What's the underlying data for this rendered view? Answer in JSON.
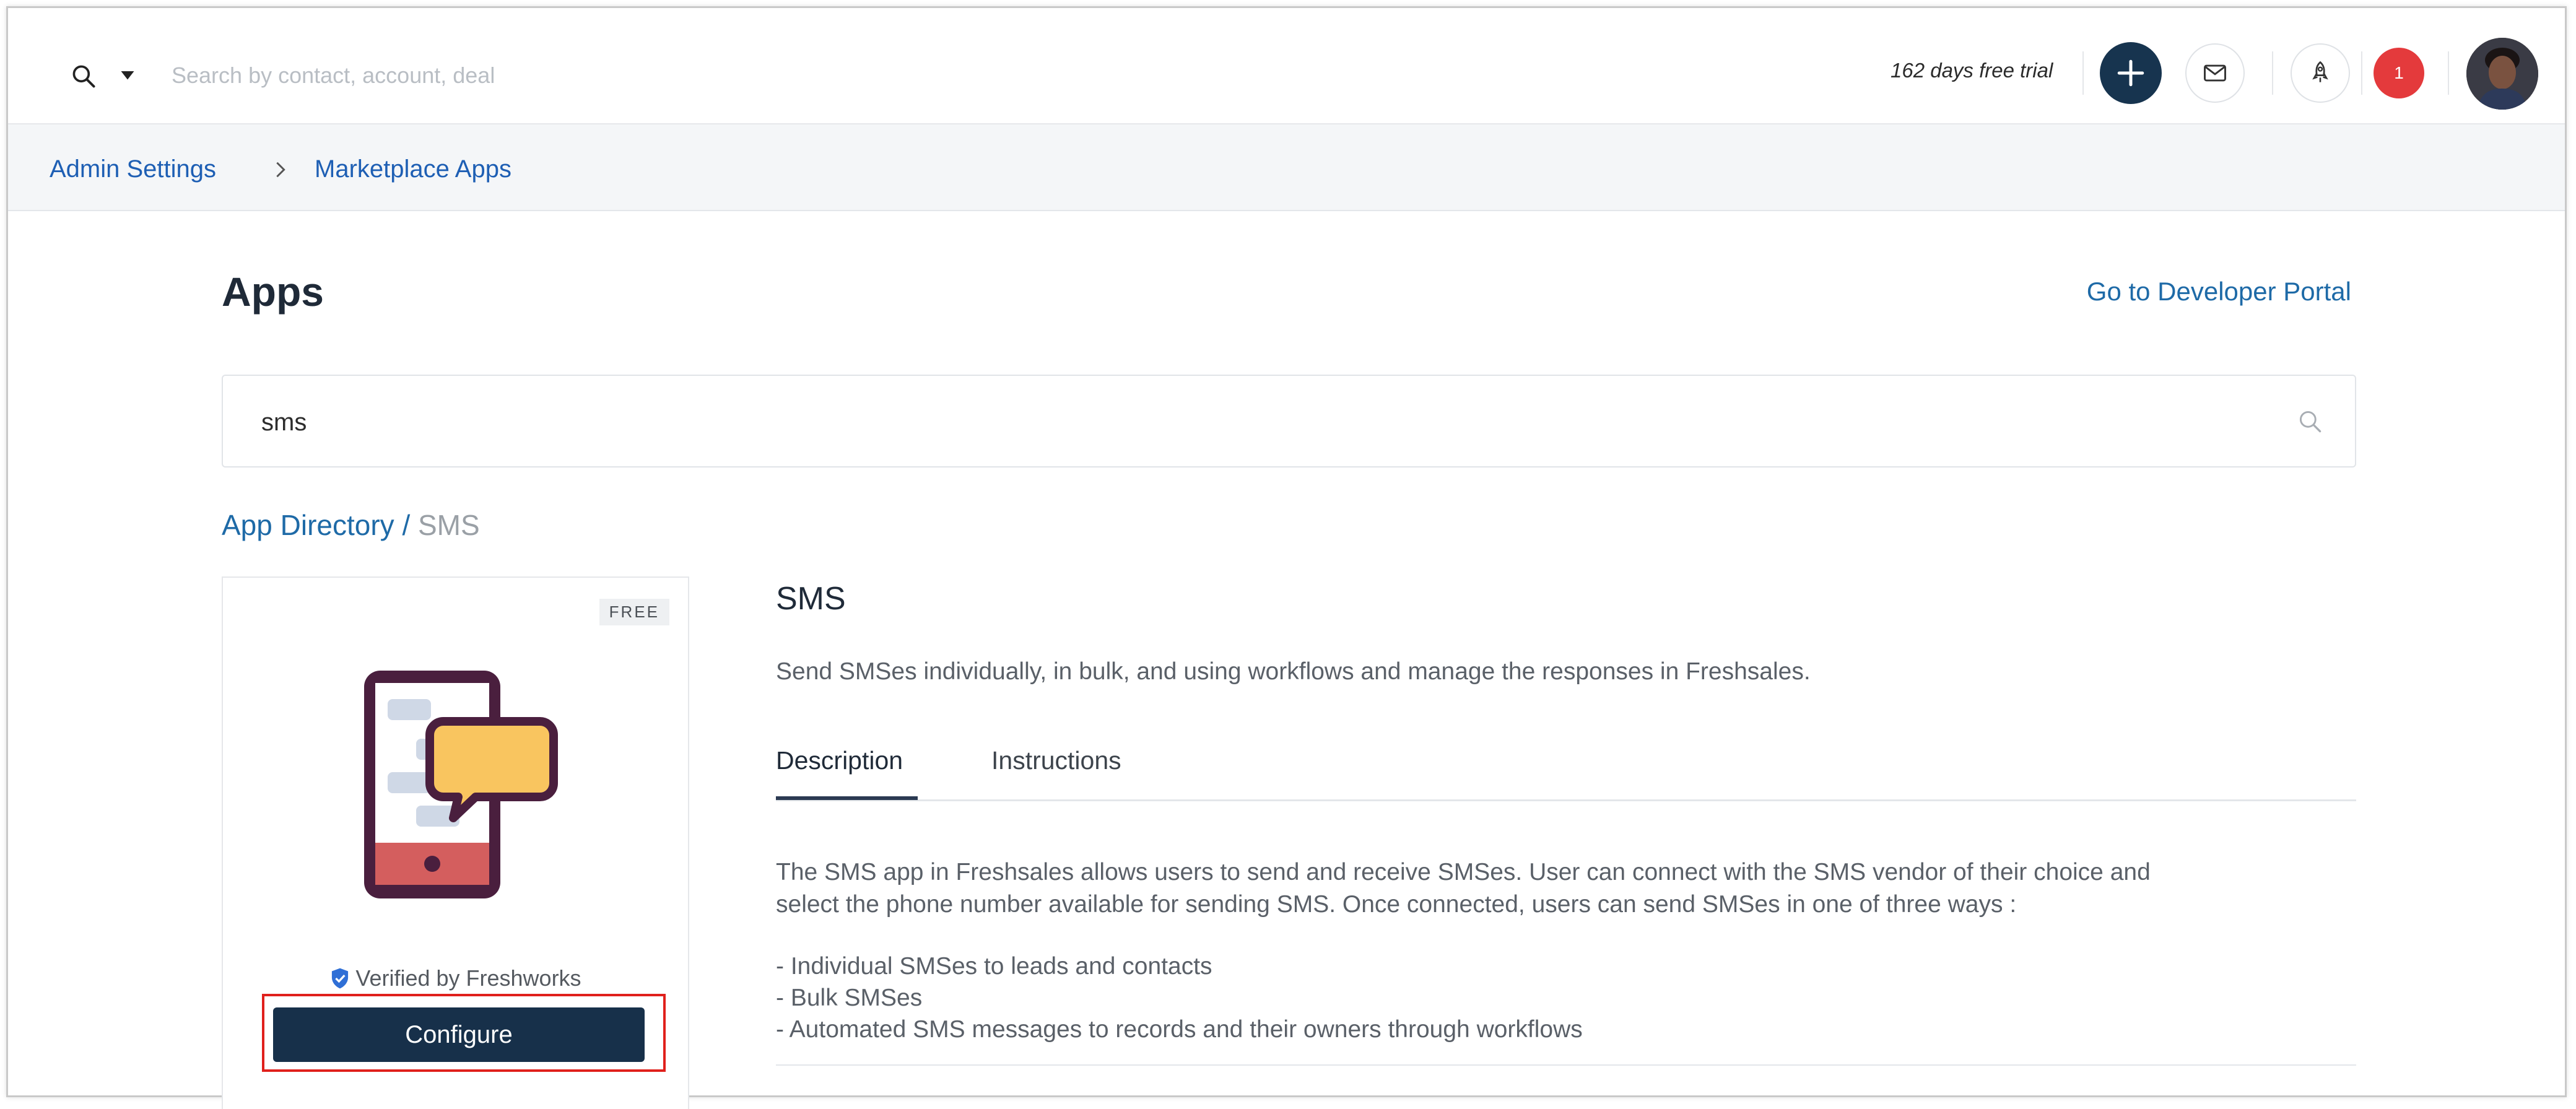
{
  "topbar": {
    "search_placeholder": "Search by contact, account, deal",
    "trial_text": "162 days free trial",
    "notification_count": "1"
  },
  "breadcrumb": {
    "items": [
      "Admin Settings",
      "Marketplace Apps"
    ]
  },
  "page": {
    "title": "Apps",
    "developer_portal_link": "Go to Developer Portal",
    "search_value": "sms",
    "directory_link": "App Directory",
    "directory_separator": "/",
    "directory_current": "SMS"
  },
  "app_card": {
    "badge": "FREE",
    "verified_text": "Verified by Freshworks",
    "configure_label": "Configure"
  },
  "app": {
    "name": "SMS",
    "summary": "Send SMSes individually, in bulk, and using workflows and manage the responses in Freshsales.",
    "tabs": [
      {
        "label": "Description",
        "active": true
      },
      {
        "label": "Instructions",
        "active": false
      }
    ],
    "description_lines": [
      "The SMS app in Freshsales allows users to send and receive SMSes. User can connect with the SMS vendor of their choice and",
      "select the phone number available for sending SMS. Once connected, users can send SMSes in one of three ways :"
    ],
    "bullets": [
      "- Individual SMSes to leads and contacts",
      "- Bulk SMSes",
      "- Automated SMS messages to records and their owners through workflows"
    ]
  },
  "colors": {
    "link_blue": "#1e6aa7",
    "primary_dark": "#17304a",
    "notification_red": "#e43a3c",
    "highlight_red": "#e0201c"
  }
}
